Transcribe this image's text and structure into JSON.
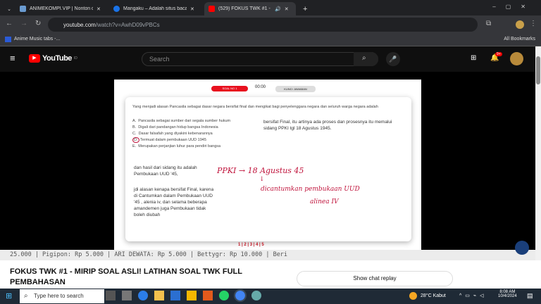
{
  "browser": {
    "tabs": [
      {
        "title": "ANIMEKOMPI.VIP | Nonton dan...",
        "color": "#6a9bd1"
      },
      {
        "title": "Mangaku – Adalah situs baca k...",
        "color": "#1a73e8"
      },
      {
        "title": "(529) FOKUS TWK #1 - MIR...",
        "color": "#ff0000",
        "active": true
      }
    ],
    "new_tab": "+",
    "url_host": "youtube.com",
    "url_path": "/watch?v=AwhD09vPBCs",
    "bookmark": "Anime Music tabs -...",
    "all_bookmarks": "All Bookmarks"
  },
  "youtube": {
    "logo": "YouTube",
    "country": "ID",
    "search_placeholder": "Search",
    "notifications": "9+"
  },
  "slide": {
    "soal_label": "SOAL NO 1",
    "timer": "00:00",
    "kunci_label": "KUNCI JAWABAN",
    "question": "Yang menjadi alasan Pancasila sebagai dasar negara bersifat final dan mengikat bagi penyelenggara negara dan seluruh warga negara adalah",
    "options": [
      {
        "letter": "A.",
        "text": "Pancasila sebagai sumber dari segala sumber hukum"
      },
      {
        "letter": "B.",
        "text": "Digali dari pandangan hidup bangsa Indonesia"
      },
      {
        "letter": "C.",
        "text": "Dasar falsafah yang diyakini kebenarannya"
      },
      {
        "letter": "D.",
        "text": "Termuat dalam pembukaan UUD 1945",
        "circled": true
      },
      {
        "letter": "E.",
        "text": "Merupakan perjanjian luhur para pendiri bangsa"
      }
    ],
    "explain_right": "bersifat Final, itu artinya ada proses dan prosesnya itu memalui sidang PPKI tgl 18 Agustus 1945.",
    "explain_left1": "dan hasil dari sidang itu adalah Pembukaan UUD '45,",
    "explain_left2": "jdi alasan kenapa bersifat Final, karena di Cantumkan dalam Pembukaan UUD '45 , alenia iv, dan selama beberapa amandemen juga Pembukaan tidak boleh diubah",
    "handwriting": [
      "PPKI → 18 Agustus 45",
      "↓",
      "dicantumkan pembukaan UUD",
      "alinea IV"
    ],
    "pages": "1 | 2 | 3 | 4 | 5"
  },
  "ticker": "25.000 | Pigipon: Rp 5.000 | ARI DEWATA: Rp 5.000 | Bettygr: Rp 10.000 | Beri",
  "video_title": "FOKUS TWK #1 - MIRIP SOAL ASLI! LATIHAN SOAL TWK FULL PEMBAHASAN",
  "chat_replay": "Show chat replay",
  "taskbar": {
    "search": "Type here to search",
    "weather": "28°C  Kabut",
    "time": "8:08 AM",
    "date": "10/4/2024"
  }
}
